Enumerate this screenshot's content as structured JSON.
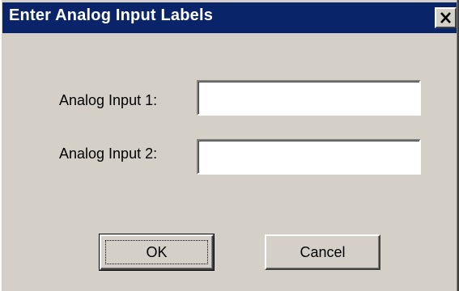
{
  "window": {
    "title": "Enter Analog Input Labels",
    "close_icon": "close-icon"
  },
  "fields": [
    {
      "label": "Analog Input 1:",
      "value": ""
    },
    {
      "label": "Analog Input 2:",
      "value": ""
    }
  ],
  "buttons": {
    "ok_label": "OK",
    "cancel_label": "Cancel"
  },
  "colors": {
    "titlebar": "#0a246a",
    "dialog_face": "#d4d0c8",
    "field_background": "#ffffff"
  }
}
